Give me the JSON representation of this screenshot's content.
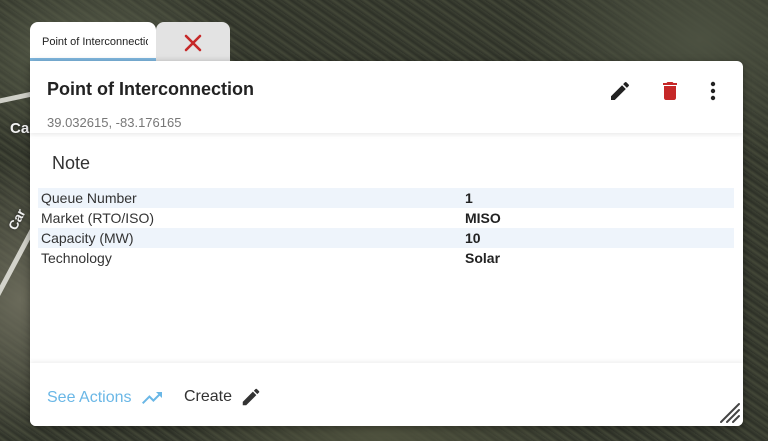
{
  "map": {
    "labels": [
      "Ca",
      "Car"
    ]
  },
  "tabs": [
    {
      "label": "Point of Interconnection",
      "active": true
    }
  ],
  "popup": {
    "title": "Point of Interconnection",
    "coordinates": "39.032615, -83.176165",
    "note_heading": "Note",
    "properties": [
      {
        "key": "Queue Number",
        "value": "1"
      },
      {
        "key": "Market (RTO/ISO)",
        "value": "MISO"
      },
      {
        "key": "Capacity (MW)",
        "value": "10"
      },
      {
        "key": "Technology",
        "value": "Solar"
      }
    ],
    "footer": {
      "see_actions_label": "See Actions",
      "create_label": "Create"
    }
  },
  "colors": {
    "accent": "#6ab7e6",
    "delete": "#c62828",
    "close": "#c62828",
    "row_stripe": "#eef4fb"
  },
  "icons": [
    "close-icon",
    "edit-icon",
    "delete-icon",
    "more-vert-icon",
    "trending-up-icon",
    "create-pencil-icon",
    "resize-handle-icon"
  ]
}
